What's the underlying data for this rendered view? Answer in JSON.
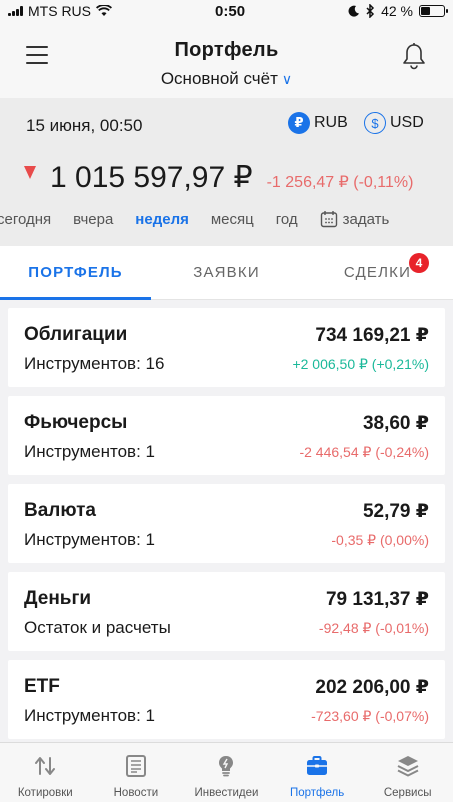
{
  "status_bar": {
    "carrier": "MTS RUS",
    "time": "0:50",
    "battery": "42 %",
    "battery_level": 0.42
  },
  "header": {
    "title": "Портфель",
    "account": "Основной счёт"
  },
  "summary": {
    "date": "15 июня, 00:50",
    "currencies": [
      {
        "code": "RUB",
        "symbol": "₽",
        "selected": true
      },
      {
        "code": "USD",
        "symbol": "$",
        "selected": false
      }
    ],
    "total": "1 015 597,97 ₽",
    "change": "-1 256,47 ₽ (-0,11%)",
    "periods": [
      {
        "label": "сегодня",
        "active": false
      },
      {
        "label": "вчера",
        "active": false
      },
      {
        "label": "неделя",
        "active": true
      },
      {
        "label": "месяц",
        "active": false
      },
      {
        "label": "год",
        "active": false
      },
      {
        "label": "задать",
        "active": false
      }
    ]
  },
  "tabs": [
    {
      "label": "ПОРТФЕЛЬ",
      "active": true
    },
    {
      "label": "ЗАЯВКИ",
      "active": false
    },
    {
      "label": "СДЕЛКИ",
      "active": false,
      "badge": "4"
    }
  ],
  "cards": [
    {
      "name": "Облигации",
      "sub": "Инструментов: 16",
      "value": "734 169,21 ₽",
      "change": "+2 006,50 ₽ (+0,21%)",
      "positive": true
    },
    {
      "name": "Фьючерсы",
      "sub": "Инструментов: 1",
      "value": "38,60 ₽",
      "change": "-2 446,54 ₽ (-0,24%)",
      "positive": false
    },
    {
      "name": "Валюта",
      "sub": "Инструментов: 1",
      "value": "52,79 ₽",
      "change": "-0,35 ₽ (0,00%)",
      "positive": false
    },
    {
      "name": "Деньги",
      "sub": "Остаток и расчеты",
      "value": "79 131,37 ₽",
      "change": "-92,48 ₽ (-0,01%)",
      "positive": false
    },
    {
      "name": "ETF",
      "sub": "Инструментов: 1",
      "value": "202 206,00 ₽",
      "change": "-723,60 ₽ (-0,07%)",
      "positive": false
    }
  ],
  "bottom_nav": [
    {
      "label": "Котировки",
      "icon": "quotes-icon",
      "active": false
    },
    {
      "label": "Новости",
      "icon": "news-icon",
      "active": false
    },
    {
      "label": "Инвестидеи",
      "icon": "lightbulb-icon",
      "active": false
    },
    {
      "label": "Портфель",
      "icon": "briefcase-icon",
      "active": true
    },
    {
      "label": "Сервисы",
      "icon": "layers-icon",
      "active": false
    }
  ],
  "colors": {
    "accent": "#1a73e8",
    "negative": "#e86b6b",
    "positive": "#1bb99a",
    "badge": "#e8232b"
  }
}
